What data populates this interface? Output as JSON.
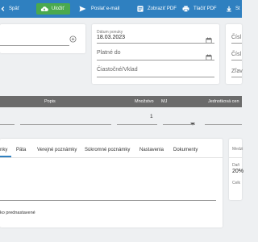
{
  "toolbar": {
    "back_label": "Späť",
    "save_label": "Uložiť",
    "email_label": "Poslať e-mail",
    "pdf_label": "Zobraziť PDF",
    "print_label": "Tlačiť PDF",
    "more_label": "St",
    "save_color": "#4aa94e",
    "bar_color": "#2f80c0"
  },
  "order_card": {
    "date_label": "Dátum ponuky",
    "date_value": "18.03.2023",
    "valid_until_placeholder": "Platné do",
    "partial_deposit_placeholder": "Čiastočné/Vklad"
  },
  "right_card": {
    "field1": "Čísl",
    "field2": "Čísl",
    "field3": "Zľav"
  },
  "table": {
    "headers": [
      "Popis",
      "Množstvo",
      "MJ",
      "Jednotková cen"
    ],
    "row": {
      "quantity": "1"
    }
  },
  "tabs": {
    "items": [
      "nky",
      "Päta",
      "Verejné poznámky",
      "Súkromné poznámky",
      "Nastavenia",
      "Dokumenty"
    ],
    "active_index": 0
  },
  "notes": {
    "default_text": "ko prednastavené"
  },
  "summary_card": {
    "label1": "Medzi",
    "tax_label": "Daň",
    "tax_value": "20%",
    "total_label": "Celk"
  },
  "icons": {
    "back": "arrow-left-icon",
    "save": "cloud-upload-icon",
    "email": "send-icon",
    "pdf": "pdf-document-icon",
    "print": "printer-icon",
    "download": "download-icon",
    "add": "add-circle-icon",
    "calendar": "calendar-icon",
    "dropdown": "caret-down-icon"
  }
}
